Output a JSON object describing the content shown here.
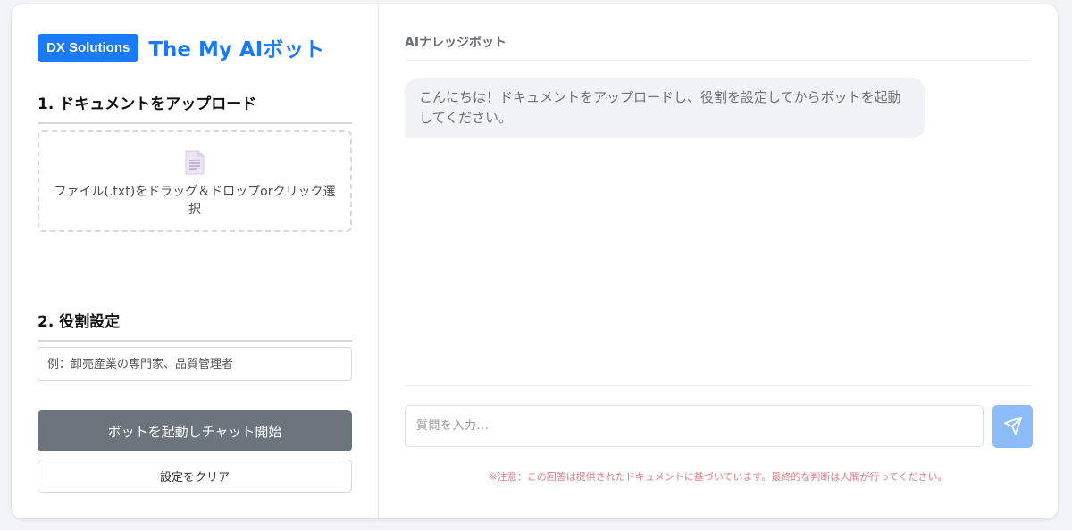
{
  "brand": {
    "badge": "DX Solutions",
    "title": "The My AIボット"
  },
  "upload": {
    "section_title": "1. ドキュメントをアップロード",
    "dropzone_text": "ファイル(.txt)をドラッグ＆ドロップorクリック選択",
    "icon": "document-icon"
  },
  "role": {
    "section_title": "2. 役割設定",
    "placeholder": "例：卸売産業の専門家、品質管理者",
    "value": ""
  },
  "buttons": {
    "start": "ボットを起動しチャット開始",
    "clear": "設定をクリア"
  },
  "chat": {
    "header": "AIナレッジボット",
    "messages": [
      {
        "role": "bot",
        "text": "こんにちは！ドキュメントをアップロードし、役割を設定してからボットを起動してください。"
      }
    ],
    "input_placeholder": "質問を入力...",
    "send_icon": "paper-plane-icon",
    "notice": "※注意：この回答は提供されたドキュメントに基づいています。最終的な判断は人間が行ってください。"
  },
  "colors": {
    "accent": "#1a7af8",
    "start_button": "#6c757d",
    "send_button": "#8cbcf8",
    "notice": "#e07c86"
  }
}
